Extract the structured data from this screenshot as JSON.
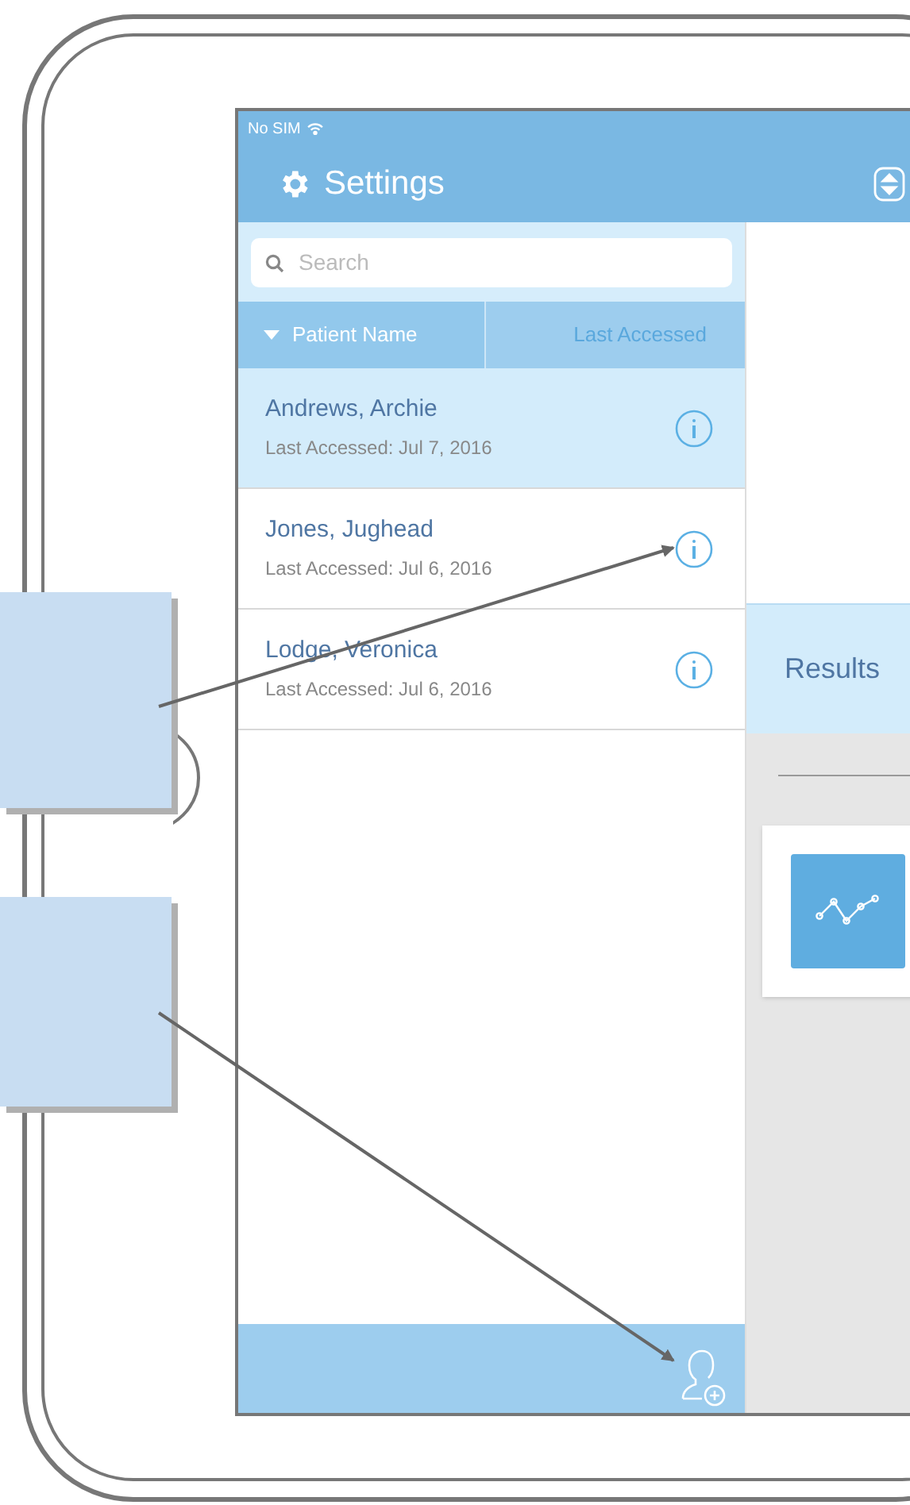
{
  "status_bar": {
    "carrier": "No SIM"
  },
  "header": {
    "title": "Settings"
  },
  "search": {
    "placeholder": "Search"
  },
  "columns": [
    {
      "label": "Patient Name",
      "selected": true
    },
    {
      "label": "Last Accessed",
      "selected": false
    }
  ],
  "patients": [
    {
      "name": "Andrews, Archie",
      "last_accessed": "Last Accessed: Jul 7, 2016",
      "selected": true
    },
    {
      "name": "Jones, Jughead",
      "last_accessed": "Last Accessed: Jul 6, 2016",
      "selected": false
    },
    {
      "name": "Lodge, Veronica",
      "last_accessed": "Last Accessed: Jul 6, 2016",
      "selected": false
    }
  ],
  "detail": {
    "results_label": "Results"
  },
  "callouts": [
    {
      "kind": "note"
    },
    {
      "kind": "note"
    }
  ]
}
